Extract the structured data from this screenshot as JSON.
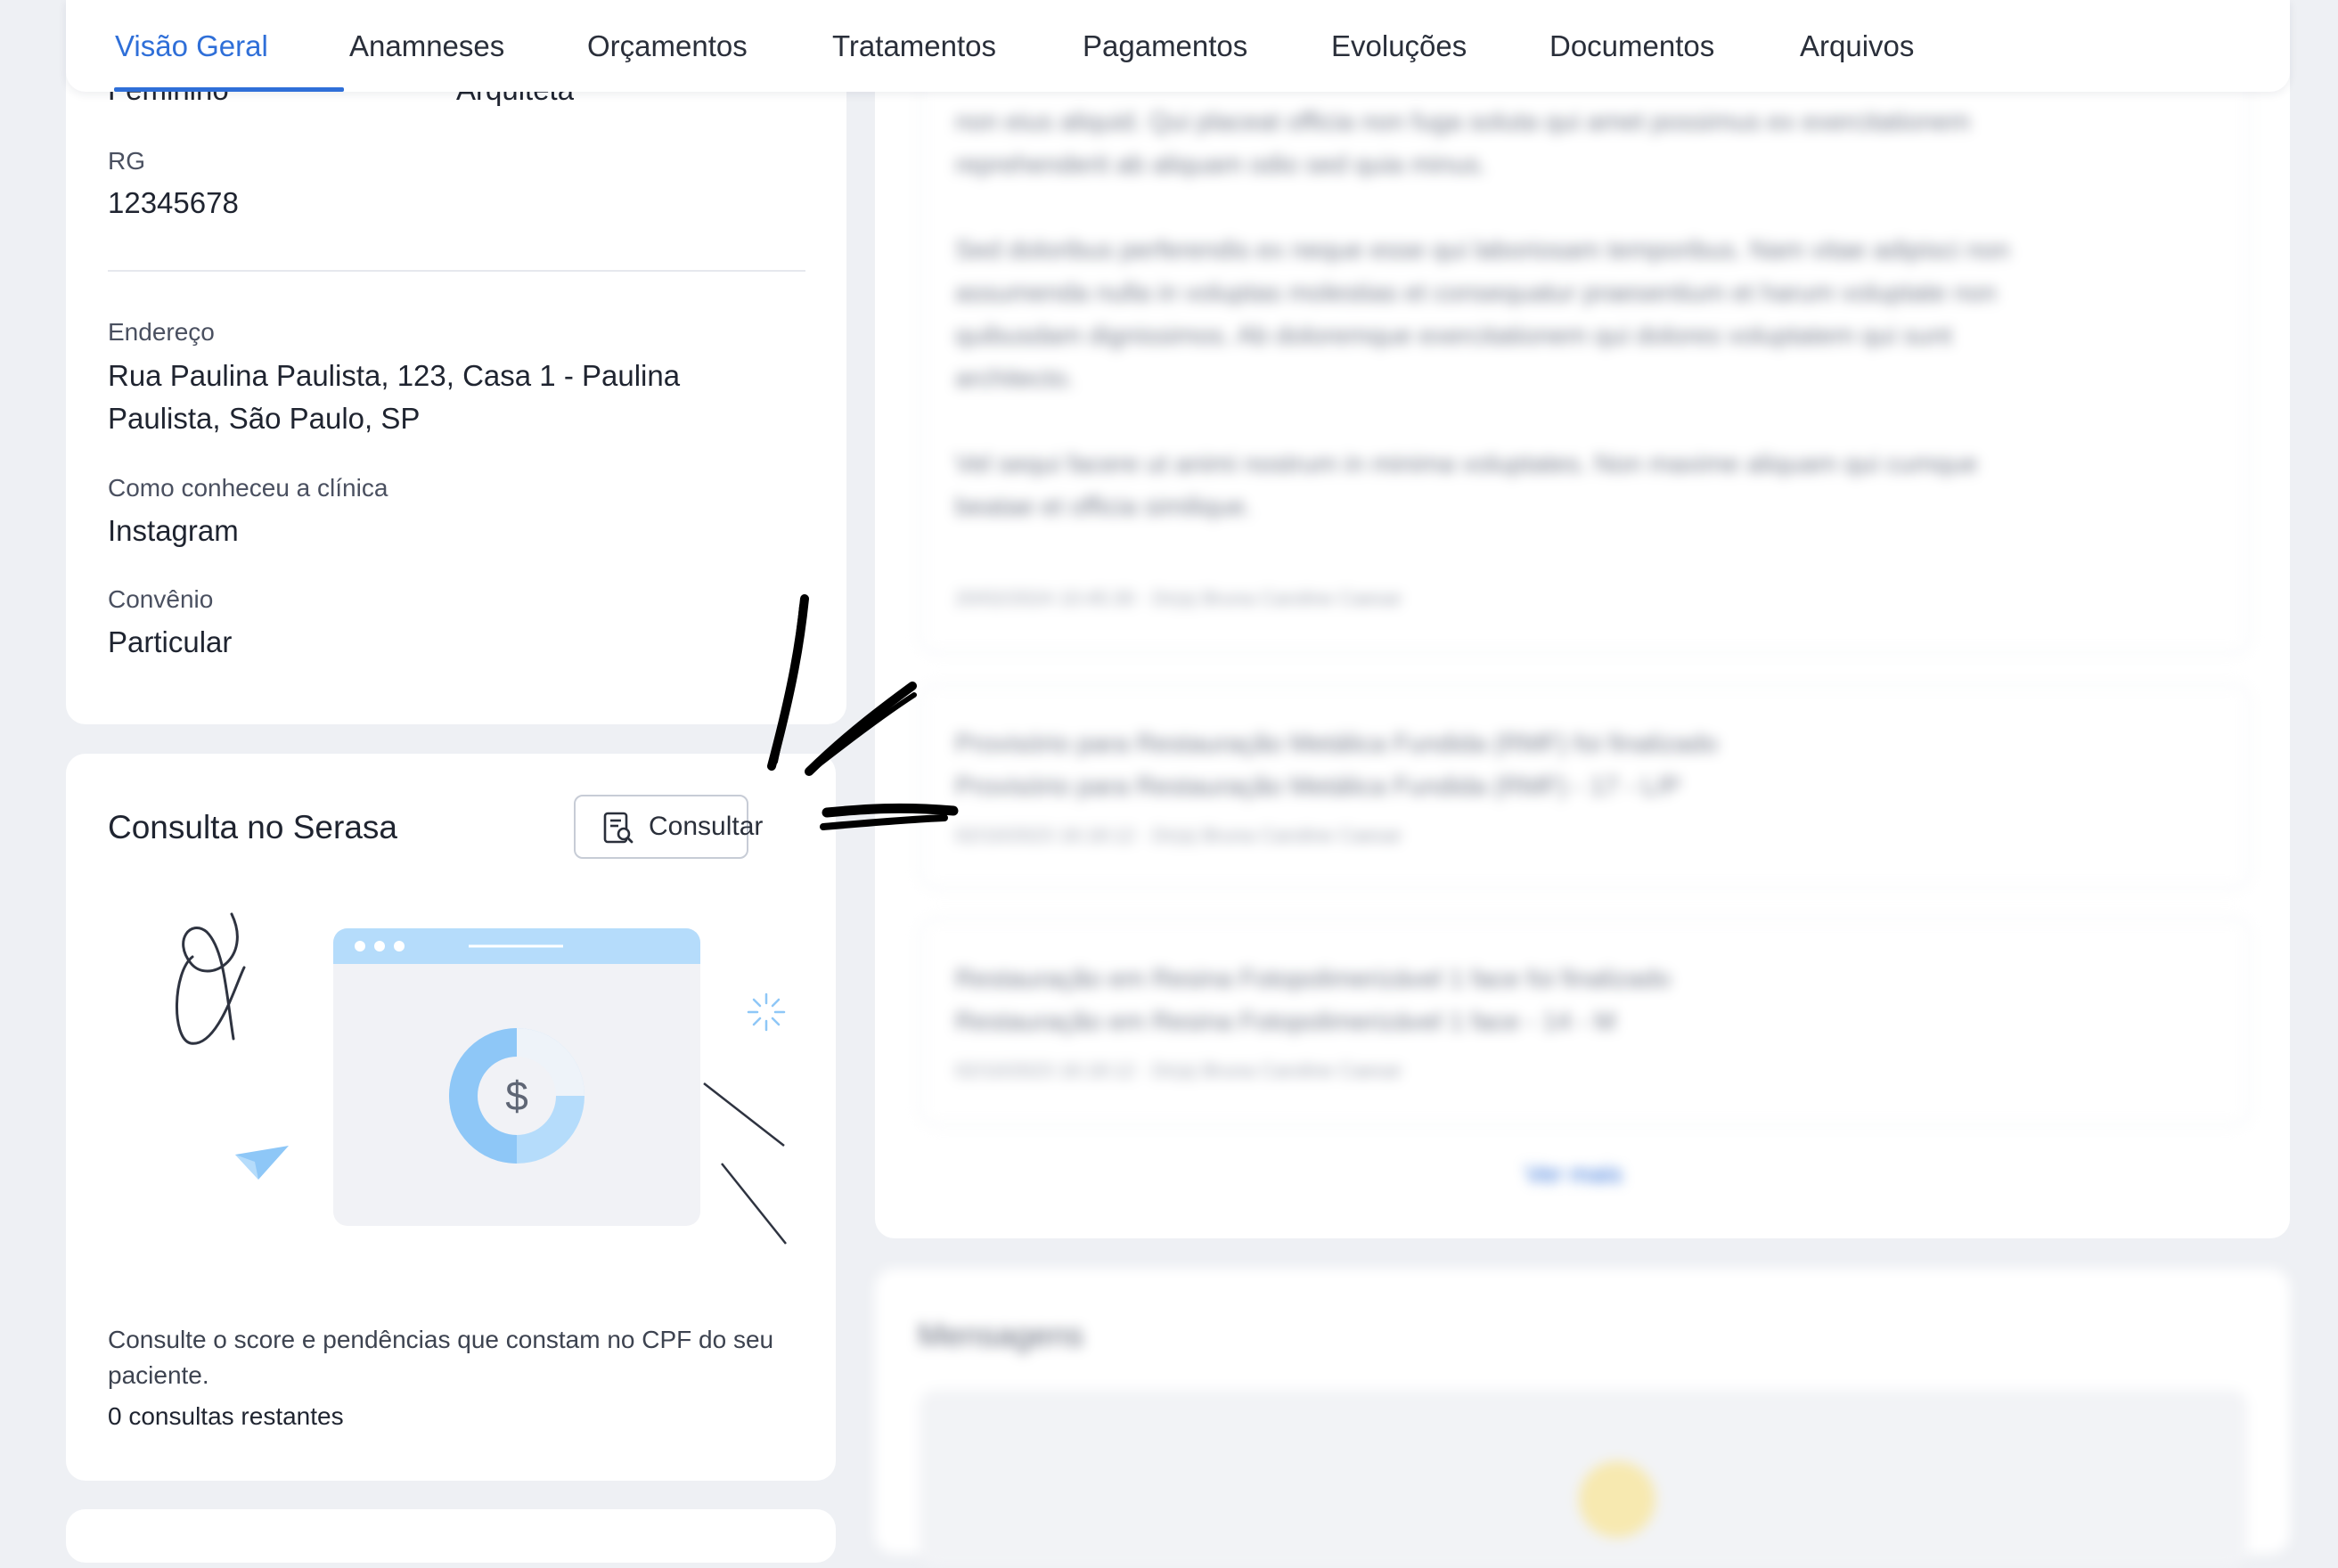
{
  "tabs": [
    {
      "label": "Visão Geral",
      "active": true
    },
    {
      "label": "Anamneses",
      "active": false
    },
    {
      "label": "Orçamentos",
      "active": false
    },
    {
      "label": "Tratamentos",
      "active": false
    },
    {
      "label": "Pagamentos",
      "active": false
    },
    {
      "label": "Evoluções",
      "active": false
    },
    {
      "label": "Documentos",
      "active": false
    },
    {
      "label": "Arquivos",
      "active": false
    }
  ],
  "patient": {
    "gender_value": "Feminino",
    "profession_value": "Arquiteta",
    "rg_label": "RG",
    "rg_value": "12345678",
    "address_label": "Endereço",
    "address_line1": "Rua Paulina Paulista, 123, Casa 1 - Paulina",
    "address_line2": "Paulista, São Paulo, SP",
    "referral_label": "Como conheceu a clínica",
    "referral_value": "Instagram",
    "insurance_label": "Convênio",
    "insurance_value": "Particular"
  },
  "serasa": {
    "title": "Consulta no Serasa",
    "button_label": "Consultar",
    "illustration_symbol": "$",
    "description": "Consulte o score e pendências que constam no CPF do seu paciente.",
    "remaining": "0 consultas restantes"
  },
  "evolutions": {
    "item1_lines": [
      "non eius aliquid. Qui placeat officia non fuga soluta qui amet possimus ex exercitationem",
      "reprehenderit ab aliquam odio sed quia minus.",
      "",
      "Sed doloribus perferendis ex neque esse qui laboriosam temporibus. Nam vitae adipisci non",
      "assumenda nulla in voluptas molestias et consequatur praesentium et harum voluptate non",
      "quibusdam dignissimos. Ab doloremque exercitationem qui dolores voluptatem qui sunt",
      "architecto.",
      "",
      "Vel sequi facere ut animi nostrum in minima voluptates. Non maxime aliquam qui cumque",
      "beatae et officia similique."
    ],
    "item1_meta": "20/02/2024 10:45:30 · Dr(a) Bruna Caroline Caesar",
    "item2_line1": "Provisório para Restauração Metálica Fundida (RMF) foi finalizado",
    "item2_line2": "Provisório para Restauração Metálica Fundida (RMF) - 17 - L/P",
    "item2_meta": "02/10/2023 16:18:12 · Dr(a) Bruna Caroline Caesar",
    "item3_line1": "Restauração em Resina Fotopolimerizável 1 face foi finalizado",
    "item3_line2": "Restauração em Resina Fotopolimerizável 1 face - 14 - M",
    "item3_meta": "02/10/2023 16:18:12 · Dr(a) Bruna Caroline Caesar",
    "see_more": "Ver mais"
  },
  "messages": {
    "title": "Mensagens"
  },
  "colors": {
    "accent": "#2f6fd8",
    "background": "#eef0f4",
    "illustration_light": "#b5dcfb",
    "illustration_mid": "#8ec7f7"
  }
}
